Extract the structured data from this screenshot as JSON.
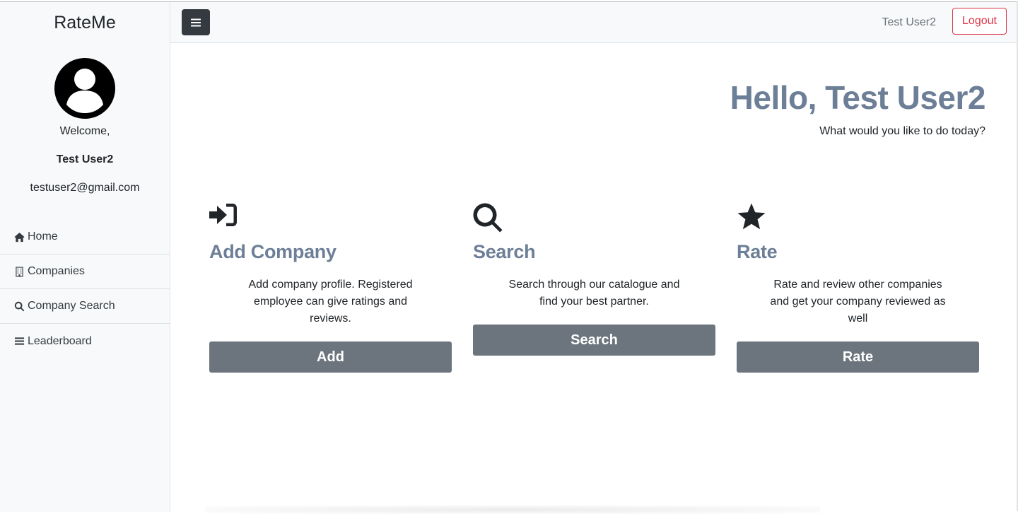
{
  "sidebar": {
    "brand": "RateMe",
    "welcome": "Welcome,",
    "user_name": "Test User2",
    "email": "testuser2@gmail.com",
    "items": [
      {
        "label": "Home",
        "icon": "home-icon"
      },
      {
        "label": "Companies",
        "icon": "building-icon"
      },
      {
        "label": "Company Search",
        "icon": "search-icon"
      },
      {
        "label": "Leaderboard",
        "icon": "bars-icon"
      }
    ]
  },
  "topbar": {
    "menu_icon": "hamburger-icon",
    "user_name": "Test User2",
    "logout_label": "Logout"
  },
  "main": {
    "greeting": "Hello, Test User2",
    "subtitle": "What would you like to do today?",
    "cards": [
      {
        "icon": "sign-in-icon",
        "title": "Add Company",
        "description": "Add company profile. Registered employee can give ratings and reviews.",
        "button": "Add"
      },
      {
        "icon": "search-icon",
        "title": "Search",
        "description": "Search through our catalogue and find your best partner.",
        "button": "Search"
      },
      {
        "icon": "star-icon",
        "title": "Rate",
        "description": "Rate and review other companies and get your company reviewed as well",
        "button": "Rate"
      }
    ]
  },
  "colors": {
    "heading": "#6c7f97",
    "button": "#6c757d",
    "danger": "#dc3545",
    "dark": "#343a40"
  }
}
